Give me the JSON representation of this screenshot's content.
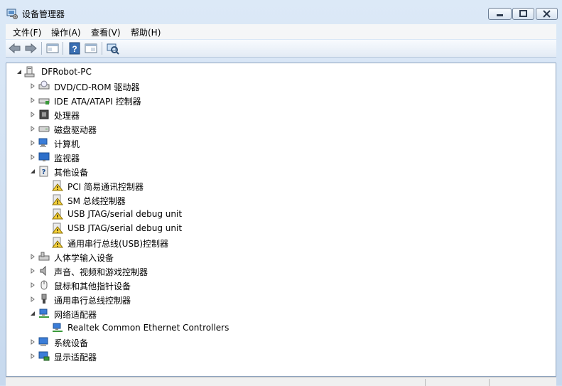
{
  "window": {
    "title": "设备管理器",
    "caption_buttons": [
      "minimize-icon",
      "restore-icon",
      "close-icon"
    ]
  },
  "menu": {
    "items": [
      {
        "id": "file",
        "label": "文件(F)"
      },
      {
        "id": "action",
        "label": "操作(A)"
      },
      {
        "id": "view",
        "label": "查看(V)"
      },
      {
        "id": "help",
        "label": "帮助(H)"
      }
    ]
  },
  "toolbar": {
    "buttons": [
      "back-arrow-icon",
      "forward-arrow-icon",
      "properties-icon",
      "help-icon",
      "show-hide-console-tree-icon",
      "scan-hardware-icon"
    ]
  },
  "tree": {
    "root": {
      "label": "DFRobot-PC",
      "expanded": true,
      "icon": "computer-icon"
    },
    "nodes": [
      {
        "label": "DVD/CD-ROM 驱动器",
        "level": 1,
        "expander": "collapsed",
        "icon": "dvd-drive-icon"
      },
      {
        "label": "IDE ATA/ATAPI 控制器",
        "level": 1,
        "expander": "collapsed",
        "icon": "ide-controller-icon"
      },
      {
        "label": "处理器",
        "level": 1,
        "expander": "collapsed",
        "icon": "processor-icon"
      },
      {
        "label": "磁盘驱动器",
        "level": 1,
        "expander": "collapsed",
        "icon": "disk-drive-icon"
      },
      {
        "label": "计算机",
        "level": 1,
        "expander": "collapsed",
        "icon": "computer-icon"
      },
      {
        "label": "监视器",
        "level": 1,
        "expander": "collapsed",
        "icon": "monitor-icon"
      },
      {
        "label": "其他设备",
        "level": 1,
        "expander": "expanded",
        "icon": "unknown-device-icon"
      },
      {
        "label": "PCI 简易通讯控制器",
        "level": 2,
        "expander": "none",
        "icon": "warning-device-icon"
      },
      {
        "label": "SM 总线控制器",
        "level": 2,
        "expander": "none",
        "icon": "warning-device-icon"
      },
      {
        "label": "USB JTAG/serial debug unit",
        "level": 2,
        "expander": "none",
        "icon": "warning-device-icon"
      },
      {
        "label": "USB JTAG/serial debug unit",
        "level": 2,
        "expander": "none",
        "icon": "warning-device-icon"
      },
      {
        "label": "通用串行总线(USB)控制器",
        "level": 2,
        "expander": "none",
        "icon": "warning-device-icon"
      },
      {
        "label": "人体学输入设备",
        "level": 1,
        "expander": "collapsed",
        "icon": "hid-icon"
      },
      {
        "label": "声音、视频和游戏控制器",
        "level": 1,
        "expander": "collapsed",
        "icon": "speaker-icon"
      },
      {
        "label": "鼠标和其他指针设备",
        "level": 1,
        "expander": "collapsed",
        "icon": "mouse-icon"
      },
      {
        "label": "通用串行总线控制器",
        "level": 1,
        "expander": "collapsed",
        "icon": "usb-plug-icon"
      },
      {
        "label": "网络适配器",
        "level": 1,
        "expander": "expanded",
        "icon": "network-adapter-icon"
      },
      {
        "label": "Realtek Common Ethernet Controllers",
        "level": 2,
        "expander": "none",
        "icon": "network-adapter-icon"
      },
      {
        "label": "系统设备",
        "level": 1,
        "expander": "collapsed",
        "icon": "system-device-icon"
      },
      {
        "label": "显示适配器",
        "level": 1,
        "expander": "collapsed",
        "icon": "display-adapter-icon"
      }
    ]
  },
  "colors": {
    "titlebar": "#dce9f7",
    "menubar": "#f5f6f7",
    "content_bg": "#ffffff",
    "close_button": "#d6e2f0",
    "warning_yellow": "#f6d23a"
  }
}
